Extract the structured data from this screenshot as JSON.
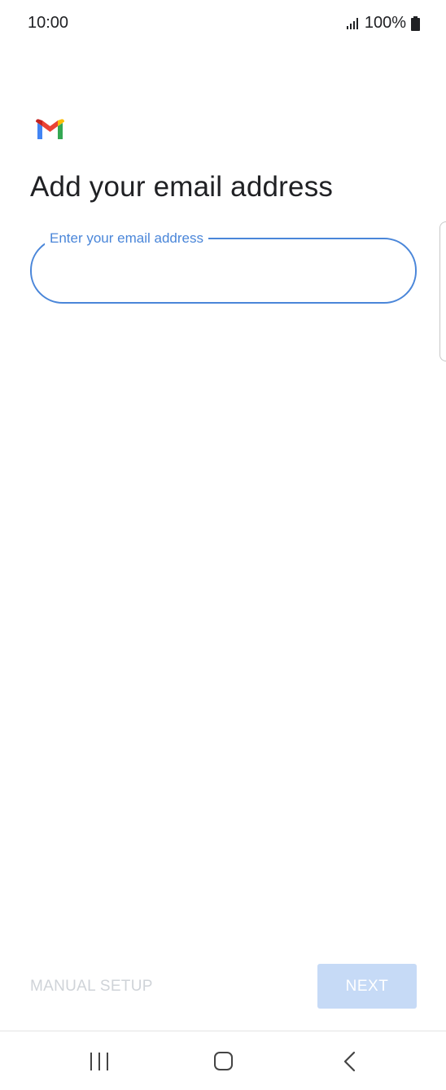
{
  "status_bar": {
    "time": "10:00",
    "battery": "100%",
    "icons": [
      "signal-icon",
      "battery-icon"
    ]
  },
  "app": {
    "logo": "gmail-logo-icon",
    "title": "Add your email address"
  },
  "email_field": {
    "label": "Enter your email address",
    "value": "",
    "placeholder": ""
  },
  "actions": {
    "manual_setup_label": "MANUAL SETUP",
    "next_label": "NEXT"
  },
  "nav_bar": {
    "icons": [
      "recents-icon",
      "home-icon",
      "back-icon"
    ]
  },
  "colors": {
    "accent": "#4a86d9",
    "next_disabled_bg": "#c6daf6",
    "manual_setup_disabled": "#cfd3d8",
    "gmail_red": "#ea4335",
    "gmail_blue": "#4285f4",
    "gmail_green": "#34a853",
    "gmail_yellow": "#fbbc04"
  }
}
